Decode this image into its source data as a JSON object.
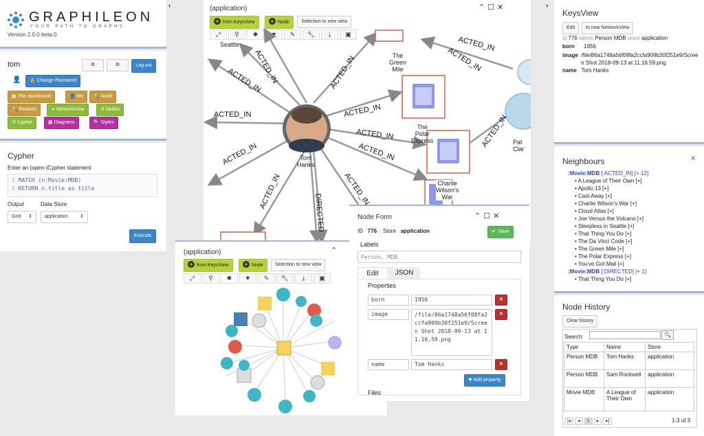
{
  "brand": {
    "name": "GRAPHILEON",
    "tagline": "YOUR PATH TO GRAPHS",
    "version": "Version 2.0.0-beta.0"
  },
  "user": {
    "name": "tom",
    "change_password": "Change Password",
    "logout": "Log out",
    "buttons": [
      "This dashboard",
      "Me",
      "Node",
      "Relation",
      "NetworkView",
      "Nodes",
      "Cypher",
      "Diagrams",
      "Styles"
    ]
  },
  "cypher": {
    "title": "Cypher",
    "prompt": "Enter an (open-)Cypher statement",
    "lines": [
      {
        "num": "1",
        "text": "MATCH (n:Movie:MDB)"
      },
      {
        "num": "2",
        "text": "RETURN n.title as title"
      }
    ],
    "output_label": "Output",
    "output_value": "Grid",
    "store_label": "Data Store",
    "store_value": "application",
    "execute": "Execute"
  },
  "main_network": {
    "title": "(application)",
    "from_keysview": "from KeysView",
    "node_btn": "Node",
    "selection_btn": "Selection to new view",
    "center_node_label": [
      "Tom",
      "Hanks"
    ],
    "node_labels": {
      "seattle": "Seattle",
      "green_mile": [
        "The",
        "Green",
        "Mile"
      ],
      "polar_express": [
        "The",
        "Polar",
        "Express"
      ],
      "charlie": [
        "Charlie",
        "Wilson's",
        "War"
      ],
      "pat": [
        "Pat",
        "Clar"
      ]
    },
    "edge_labels": [
      "ACTED_IN",
      "ACTED_IN",
      "ACTED_IN",
      "ACTED_IN",
      "ACTED_IN",
      "ACTED_IN",
      "ACTED_IN",
      "ACTED_IN",
      "ACTED_IN",
      "ACTED_IN",
      "ACTED_IN",
      "ACTED_IN",
      "ACTED_IN",
      "DIRECTED"
    ]
  },
  "mini_network": {
    "title": "(application)",
    "from_keysview": "from KeysView",
    "node_btn": "Node",
    "selection_btn": "Selection to new view"
  },
  "node_form": {
    "title": "Node Form",
    "id_label": "ID",
    "id_value": "776",
    "store_label": "Store",
    "store_value": "application",
    "save": "Save",
    "labels_heading": "Labels",
    "labels_value": "Person, MDB",
    "tab_edit": "Edit",
    "tab_json": "JSON",
    "properties_heading": "Properties",
    "properties": [
      {
        "key": "born",
        "value": "1956"
      },
      {
        "key": "image",
        "value": "/file/86a1748a56f08fa2ccfa909b30f251e9/Screen Shot 2018-09-13 at 11.16.59.png"
      },
      {
        "key": "name",
        "value": "Tom Hanks"
      }
    ],
    "add_property": "Add property",
    "files_heading": "Files"
  },
  "keysview": {
    "title": "KeysView",
    "edit": "Edit",
    "to_network": "to new NetworkView",
    "id_key": "id",
    "id_value": "776",
    "labels_key": "labels",
    "labels_value": "Person MDB",
    "store_key": "store",
    "store_value": "application",
    "rows": [
      {
        "key": "born",
        "value": "1956"
      },
      {
        "key": "image",
        "value": "/file/86a1748a56f08fa2ccfa909b30f251e9/Screen Shot 2018-09-13 at 11.16.59.png"
      },
      {
        "key": "name",
        "value": "Tom Hanks"
      }
    ]
  },
  "neighbours": {
    "title": "Neighbours",
    "group1_head": ":Movie:MDB",
    "group1_rel": "[:ACTED_IN]",
    "group1_count": "[+ 12]",
    "group1": [
      "A League of Their Own [+]",
      "Apollo 13 [+]",
      "Cast Away [+]",
      "Charlie Wilson's War [+]",
      "Cloud Atlas [+]",
      "Joe Versus the Volcano [+]",
      "Sleepless in Seattle [+]",
      "That Thing You Do [+]",
      "The Da Vinci Code [+]",
      "The Green Mile [+]",
      "The Polar Express [+]",
      "You've Got Mail [+]"
    ],
    "group2_head": ":Movie:MDB",
    "group2_rel": "[:DIRECTED]",
    "group2_count": "[+ 1]",
    "group2": [
      "That Thing You Do [+]"
    ]
  },
  "history": {
    "title": "Node History",
    "clear": "Clear history",
    "search_label": "Search:",
    "columns": [
      "Type",
      "Name",
      "Store"
    ],
    "rows": [
      [
        "Person MDB",
        "Tom Hanks",
        "application"
      ],
      [
        "Person MDB",
        "Sam Rockwell",
        "application"
      ],
      [
        "Movie MDB",
        "A League of Their Own",
        "application"
      ]
    ],
    "page": "1",
    "count": "1-3 of 3"
  },
  "colors": {
    "accent_green": "#b5d33d",
    "accent_blue": "#3a86c8",
    "film_red": "#e05a4a",
    "film_blue": "#8e97e8"
  }
}
